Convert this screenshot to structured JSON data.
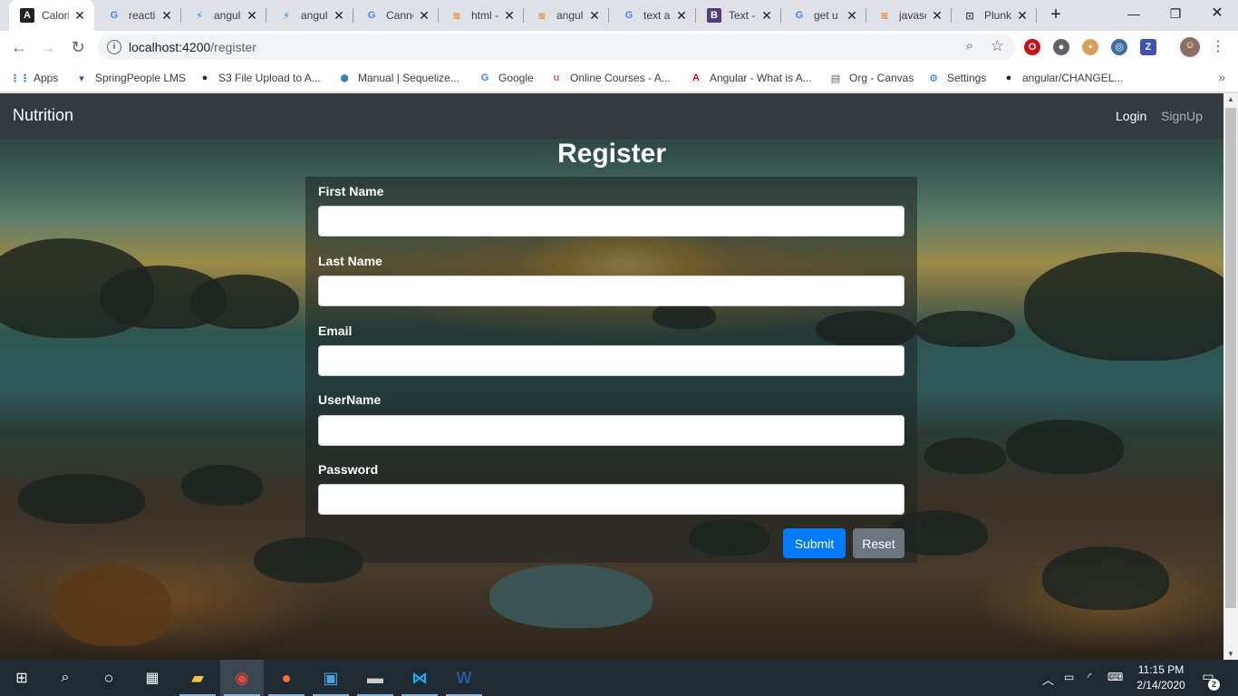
{
  "browser": {
    "tabs": [
      {
        "title": "Calori",
        "icon": "angular-icon",
        "glyph": "A",
        "color": "#202124",
        "fg": "#fff",
        "active": true
      },
      {
        "title": "reacti",
        "icon": "google-icon",
        "glyph": "G",
        "color": "transparent",
        "fg": "#4285f4",
        "active": false
      },
      {
        "title": "angul",
        "icon": "bolt-icon",
        "glyph": "⚡",
        "color": "transparent",
        "fg": "#1e88e5",
        "active": false
      },
      {
        "title": "angul",
        "icon": "bolt-icon",
        "glyph": "⚡",
        "color": "transparent",
        "fg": "#1e88e5",
        "active": false
      },
      {
        "title": "Canno",
        "icon": "google-icon",
        "glyph": "G",
        "color": "transparent",
        "fg": "#4285f4",
        "active": false
      },
      {
        "title": "html -",
        "icon": "stackoverflow-icon",
        "glyph": "≋",
        "color": "transparent",
        "fg": "#f48024",
        "active": false
      },
      {
        "title": "angul",
        "icon": "stackoverflow-icon",
        "glyph": "≋",
        "color": "transparent",
        "fg": "#f48024",
        "active": false
      },
      {
        "title": "text a",
        "icon": "google-icon",
        "glyph": "G",
        "color": "transparent",
        "fg": "#4285f4",
        "active": false
      },
      {
        "title": "Text -",
        "icon": "bootstrap-icon",
        "glyph": "B",
        "color": "#563d7c",
        "fg": "#fff",
        "active": false
      },
      {
        "title": "get u",
        "icon": "google-icon",
        "glyph": "G",
        "color": "transparent",
        "fg": "#4285f4",
        "active": false
      },
      {
        "title": "javasc",
        "icon": "stackoverflow-icon",
        "glyph": "≋",
        "color": "transparent",
        "fg": "#f48024",
        "active": false
      },
      {
        "title": "Plunk",
        "icon": "plunker-icon",
        "glyph": "⊡",
        "color": "transparent",
        "fg": "#333",
        "active": false
      }
    ],
    "url_host": "localhost:4200",
    "url_path": "/register",
    "bookmarks": [
      {
        "label": "Apps",
        "icon": "apps-grid-icon",
        "glyph": "⋮⋮",
        "fg": "#1a73e8"
      },
      {
        "label": "SpringPeople LMS",
        "icon": "springpeople-icon",
        "glyph": "▾",
        "fg": "#8e24aa"
      },
      {
        "label": "S3 File Upload to A...",
        "icon": "github-icon",
        "glyph": "●",
        "fg": "#24292e"
      },
      {
        "label": "Manual | Sequelize...",
        "icon": "sequelize-icon",
        "glyph": "⬢",
        "fg": "#3b82c4"
      },
      {
        "label": "Google",
        "icon": "google-icon",
        "glyph": "G",
        "fg": "#4285f4"
      },
      {
        "label": "Online Courses - A...",
        "icon": "udemy-icon",
        "glyph": "u",
        "fg": "#ec5252"
      },
      {
        "label": "Angular - What is A...",
        "icon": "angular-icon",
        "glyph": "A",
        "fg": "#dd0031"
      },
      {
        "label": "Org - Canvas",
        "icon": "document-icon",
        "glyph": "▤",
        "fg": "#5f6368"
      },
      {
        "label": "Settings",
        "icon": "gear-icon",
        "glyph": "⚙",
        "fg": "#1a73e8"
      },
      {
        "label": "angular/CHANGEL...",
        "icon": "github-icon",
        "glyph": "●",
        "fg": "#24292e"
      }
    ]
  },
  "app": {
    "brand": "Nutrition",
    "nav": {
      "login": "Login",
      "signup": "SignUp"
    },
    "heading": "Register",
    "fields": [
      {
        "label": "First Name",
        "value": "",
        "type": "text"
      },
      {
        "label": "Last Name",
        "value": "",
        "type": "text"
      },
      {
        "label": "Email",
        "value": "",
        "type": "email"
      },
      {
        "label": "UserName",
        "value": "",
        "type": "text"
      },
      {
        "label": "Password",
        "value": "",
        "type": "password"
      }
    ],
    "submit_label": "Submit",
    "reset_label": "Reset",
    "colors": {
      "navbar": "#343a40",
      "primary": "#007bff",
      "secondary": "#6c757d"
    }
  },
  "taskbar": {
    "time": "11:15 PM",
    "date": "2/14/2020",
    "notification_count": "2",
    "apps": [
      {
        "name": "file-explorer-icon",
        "glyph": "▰",
        "fg": "#f6c343"
      },
      {
        "name": "chrome-icon",
        "glyph": "◉",
        "fg": "#e8453c"
      },
      {
        "name": "firefox-icon",
        "glyph": "●",
        "fg": "#ff7139"
      },
      {
        "name": "remote-desktop-icon",
        "glyph": "▣",
        "fg": "#4aa3df"
      },
      {
        "name": "terminal-icon",
        "glyph": "▬",
        "fg": "#cccccc"
      },
      {
        "name": "vscode-icon",
        "glyph": "⋈",
        "fg": "#23a9f2"
      },
      {
        "name": "word-icon",
        "glyph": "W",
        "fg": "#2b579a"
      }
    ]
  }
}
